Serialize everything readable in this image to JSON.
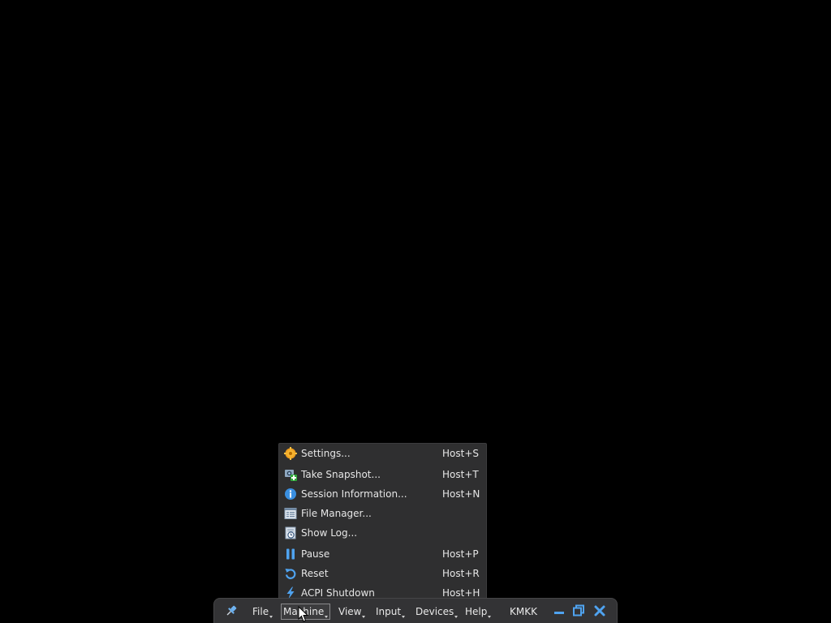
{
  "menu": {
    "items": [
      {
        "label": "Settings...",
        "shortcut": "Host+S",
        "icon": "gear-icon"
      },
      {
        "label": "Take Snapshot...",
        "shortcut": "Host+T",
        "icon": "snapshot-icon"
      },
      {
        "label": "Session Information...",
        "shortcut": "Host+N",
        "icon": "info-icon"
      },
      {
        "label": "File Manager...",
        "shortcut": "",
        "icon": "file-manager-icon"
      },
      {
        "label": "Show Log...",
        "shortcut": "",
        "icon": "log-icon"
      },
      {
        "label": "Pause",
        "shortcut": "Host+P",
        "icon": "pause-icon"
      },
      {
        "label": "Reset",
        "shortcut": "Host+R",
        "icon": "reset-icon"
      },
      {
        "label": "ACPI Shutdown",
        "shortcut": "Host+H",
        "icon": "power-icon"
      }
    ]
  },
  "toolbar": {
    "file_label": "File",
    "machine_label": "Machine",
    "view_label": "View",
    "input_label": "Input",
    "devices_label": "Devices",
    "help_label": "Help",
    "vm_name": "KMKK"
  },
  "colors": {
    "background": "#000000",
    "menu_background": "#2f2f30",
    "toolbar_background": "#333335",
    "accent_blue": "#3a8fe0",
    "text": "#e6e6e6"
  }
}
